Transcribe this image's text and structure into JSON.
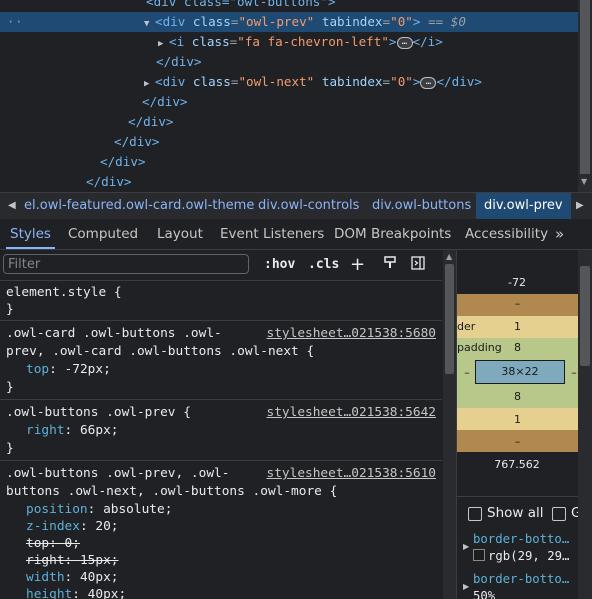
{
  "dom_tree": {
    "lines": [
      {
        "indent": 0,
        "text": "<div class=\"owl-buttons\">"
      },
      {
        "tag_open": "<div ",
        "attr": "class",
        "val": "\"owl-prev\"",
        "attr2": "tabindex",
        "val2": "\"0\"",
        "suffix": "== $0"
      },
      {
        "text_a": "<i ",
        "attr": "class",
        "val": "\"fa fa-chevron-left\"",
        "text_b": "</i>"
      },
      {
        "text": "</div>"
      },
      {
        "tag_open": "<div ",
        "attr": "class",
        "val": "\"owl-next\"",
        "attr2": "tabindex",
        "val2": "\"0\"",
        "close": "</div>"
      },
      {
        "text": "</div>"
      },
      {
        "text": "</div>"
      },
      {
        "text": "</div>"
      },
      {
        "text": "</div>"
      },
      {
        "text": "</div>"
      }
    ],
    "ellipsis": "…",
    "equals": "=",
    "gt": ">"
  },
  "breadcrumbs": {
    "items": [
      "el.owl-featured.owl-card.owl-theme",
      "div.owl-controls",
      "div.owl-buttons",
      "div.owl-prev"
    ],
    "active_index": 3
  },
  "tabs": {
    "items": [
      "Styles",
      "Computed",
      "Layout",
      "Event Listeners",
      "DOM Breakpoints",
      "Accessibility"
    ],
    "active": "Styles",
    "more": "»"
  },
  "styles": {
    "filter_placeholder": "Filter",
    "hov": ":hov",
    "cls": ".cls",
    "rules": [
      {
        "selector": [
          "element.style {"
        ],
        "source": "",
        "props": [],
        "close": "}"
      },
      {
        "selector": [
          ".owl-card .owl-buttons .owl-",
          "prev, .owl-card .owl-buttons .owl-next {"
        ],
        "source": "stylesheet…021538:5680",
        "props": [
          {
            "name": "top",
            "value": "-72px;",
            "struck": false
          }
        ],
        "close": "}"
      },
      {
        "selector": [
          ".owl-buttons .owl-prev {"
        ],
        "source": "stylesheet…021538:5642",
        "props": [
          {
            "name": "right",
            "value": "66px;",
            "struck": false
          }
        ],
        "close": "}"
      },
      {
        "selector": [
          ".owl-buttons .owl-prev, .owl-",
          "buttons .owl-next, .owl-buttons .owl-more {"
        ],
        "source": "stylesheet…021538:5610",
        "props": [
          {
            "name": "position",
            "value": "absolute;",
            "struck": false
          },
          {
            "name": "z-index",
            "value": "20;",
            "struck": false
          },
          {
            "name": "top",
            "value": "0;",
            "struck": true
          },
          {
            "name": "right",
            "value": "15px;",
            "struck": true
          },
          {
            "name": "width",
            "value": "40px;",
            "struck": false
          },
          {
            "name": "height",
            "value": "40px;",
            "struck": false
          }
        ],
        "close": ""
      }
    ]
  },
  "box_model": {
    "position_top": "-72",
    "margin_top": "–",
    "border_label": "der",
    "border_top": "1",
    "padding_label": "padding",
    "padding_top": "8",
    "padding_left": "–",
    "content_size": "38×22",
    "padding_right": "–",
    "padding_bottom": "8",
    "border_bottom": "1",
    "margin_bottom": "–",
    "position_bottom": "767.562",
    "colors": {
      "margin": "#b08850",
      "border": "#e6d090",
      "padding": "#b8c88a",
      "content": "#7fa9bc"
    }
  },
  "computed": {
    "show_all": "Show all",
    "group_letter": "G",
    "props": [
      {
        "name": "border-botto…",
        "value": "rgb(29, 29…"
      },
      {
        "name": "border-botto…",
        "value": "50%"
      }
    ]
  }
}
